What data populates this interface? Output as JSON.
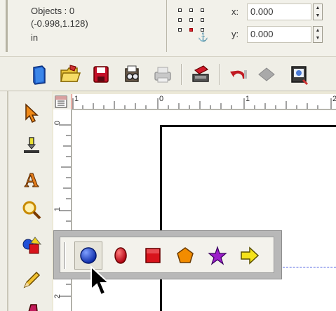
{
  "info": {
    "objects": "Objects : 0",
    "position": "(-0.998,1.128)",
    "units": "in"
  },
  "coords": {
    "x_label": "x:",
    "x_value": "0.000",
    "y_label": "y:",
    "y_value": "0.000"
  },
  "toolbar": {
    "buttons": [
      "new-document",
      "open-folder",
      "save",
      "print-preview",
      "print",
      "stamp",
      "undo",
      "redo",
      "export"
    ]
  },
  "toolbox": {
    "tools": [
      "pointer",
      "pen-tool",
      "text",
      "zoom",
      "shapes",
      "pencil",
      "brush"
    ]
  },
  "ruler": {
    "h_labels": [
      "1",
      "0",
      "1",
      "2"
    ],
    "v_labels": [
      "0",
      "1",
      "2"
    ]
  },
  "shape_palette": {
    "shapes": [
      "circle",
      "ellipse",
      "rectangle",
      "pentagon",
      "star",
      "arrow"
    ],
    "selected": "circle"
  },
  "colors": {
    "circle": "#1e3fd6",
    "shape_red": "#d8141c",
    "pentagon": "#f28c00",
    "star": "#9b1fc9",
    "arrow": "#f4e21a",
    "guide": "#4c5ee0"
  }
}
